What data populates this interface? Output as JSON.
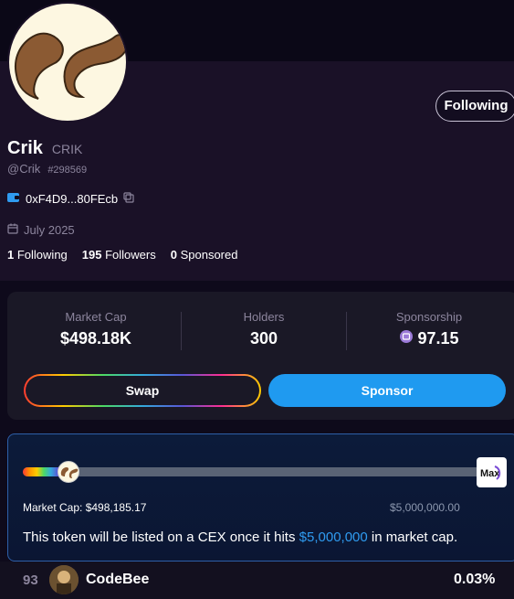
{
  "profile": {
    "name": "Crik",
    "ticker": "CRIK",
    "handle": "@Crik",
    "user_id": "#298569",
    "wallet": "0xF4D9...80FEcb",
    "joined": "July 2025",
    "follow_button": "Following",
    "stats": {
      "following_count": "1",
      "following_label": "Following",
      "followers_count": "195",
      "followers_label": "Followers",
      "sponsored_count": "0",
      "sponsored_label": "Sponsored"
    }
  },
  "metrics": {
    "market_cap_label": "Market Cap",
    "market_cap_value": "$498.18K",
    "holders_label": "Holders",
    "holders_value": "300",
    "sponsorship_label": "Sponsorship",
    "sponsorship_value": "97.15"
  },
  "actions": {
    "swap": "Swap",
    "sponsor": "Sponsor"
  },
  "progress": {
    "current_label": "Market Cap: $498,185.17",
    "goal_label": "$5,000,000.00",
    "fraction": 0.0996,
    "goal_icon_text": "Max",
    "message_pre": "This token will be listed on a CEX once it hits ",
    "message_highlight": "$5,000,000",
    "message_post": " in market cap."
  },
  "holder_row": {
    "rank": "93",
    "name": "CodeBee",
    "percent": "0.03%"
  },
  "colors": {
    "accent": "#1f9af0",
    "background": "#0e0a1b",
    "muted": "#8c859d"
  }
}
